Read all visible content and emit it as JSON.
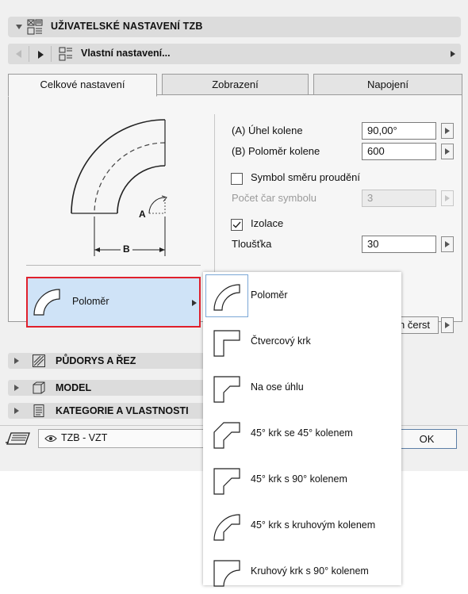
{
  "header": {
    "title": "UŽIVATELSKÉ NASTAVENÍ TZB"
  },
  "navbar": {
    "title": "Vlastní nastavení..."
  },
  "tabs": [
    {
      "label": "Celkové nastavení",
      "active": true
    },
    {
      "label": "Zobrazení",
      "active": false
    },
    {
      "label": "Napojení",
      "active": false
    }
  ],
  "diagram": {
    "label_a": "A",
    "label_b": "B"
  },
  "fields": {
    "angle": {
      "label": "(A) Úhel kolene",
      "value": "90,00°"
    },
    "radius": {
      "label": "(B) Poloměr kolene",
      "value": "600"
    },
    "flow_symbol": {
      "label": "Symbol směru proudění",
      "checked": false
    },
    "symbol_lines": {
      "label": "Počet čar symbolu",
      "value": "3"
    },
    "insulation": {
      "label": "Izolace",
      "checked": true
    },
    "thickness": {
      "label": "Tloušťka",
      "value": "30"
    }
  },
  "selector": {
    "label": "Poloměr"
  },
  "refresh": {
    "partial_label": "n čerst"
  },
  "sections": [
    {
      "label": "PŮDORYS A ŘEZ"
    },
    {
      "label": "MODEL"
    },
    {
      "label": "KATEGORIE A VLASTNOSTI"
    }
  ],
  "footer": {
    "layer": "TZB - VZT",
    "ok_label": "OK"
  },
  "dropdown": {
    "items": [
      {
        "label": "Poloměr",
        "icon": "elbow-radius-icon",
        "selected": true
      },
      {
        "label": "Čtvercový krk",
        "icon": "elbow-square-throat-icon",
        "selected": false
      },
      {
        "label": "Na ose úhlu",
        "icon": "elbow-mitered-icon",
        "selected": false
      },
      {
        "label": "45° krk se 45° kolenem",
        "icon": "elbow-45-throat-45-heel-icon",
        "selected": false
      },
      {
        "label": "45° krk s 90° kolenem",
        "icon": "elbow-45-throat-90-heel-icon",
        "selected": false
      },
      {
        "label": "45° krk s kruhovým kolenem",
        "icon": "elbow-45-throat-round-heel-icon",
        "selected": false
      },
      {
        "label": "Kruhový krk s 90° kolenem",
        "icon": "elbow-round-throat-90-heel-icon",
        "selected": false
      }
    ]
  },
  "colors": {
    "selection_border": "#e0202c",
    "selection_fill": "#cfe3f7",
    "panel_bg": "#f0f0f0"
  }
}
